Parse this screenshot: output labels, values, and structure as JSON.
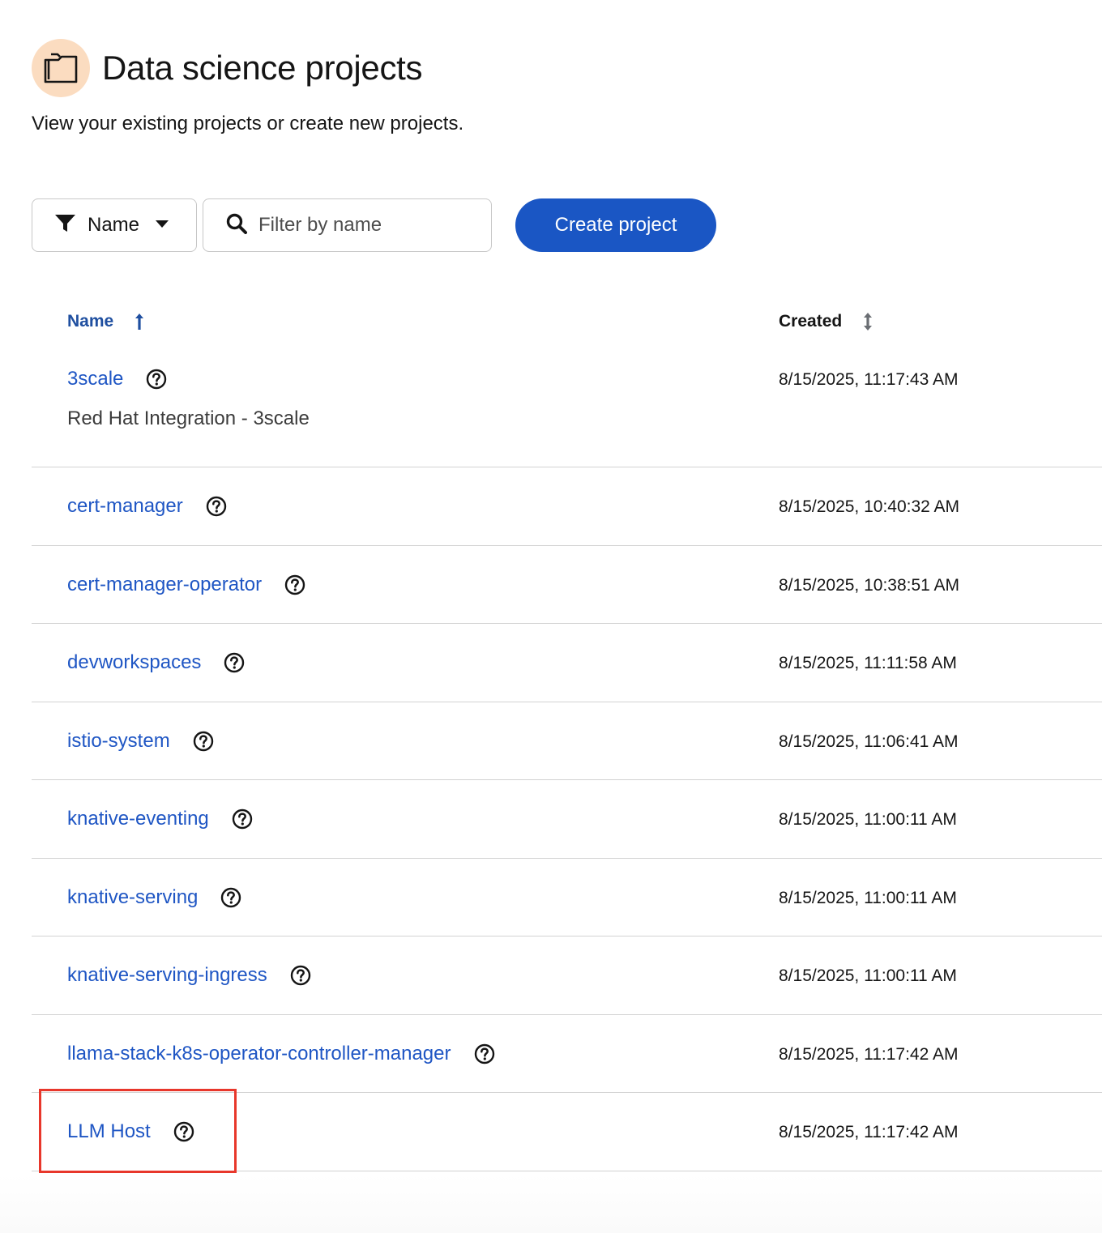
{
  "header": {
    "icon": "folder-icon",
    "title": "Data science projects",
    "description": "View your existing projects or create new projects."
  },
  "toolbar": {
    "filter_icon": "filter-icon",
    "filter_attribute": "Name",
    "search_placeholder": "Filter by name",
    "create_label": "Create project"
  },
  "table": {
    "columns": [
      {
        "label": "Name",
        "sort": "ascending"
      },
      {
        "label": "Created",
        "sort": "none"
      }
    ],
    "rows": [
      {
        "name": "3scale",
        "subtitle": "Red Hat Integration - 3scale",
        "created": "8/15/2025, 11:17:43 AM"
      },
      {
        "name": "cert-manager",
        "subtitle": "",
        "created": "8/15/2025, 10:40:32 AM"
      },
      {
        "name": "cert-manager-operator",
        "subtitle": "",
        "created": "8/15/2025, 10:38:51 AM"
      },
      {
        "name": "devworkspaces",
        "subtitle": "",
        "created": "8/15/2025, 11:11:58 AM"
      },
      {
        "name": "istio-system",
        "subtitle": "",
        "created": "8/15/2025, 11:06:41 AM"
      },
      {
        "name": "knative-eventing",
        "subtitle": "",
        "created": "8/15/2025, 11:00:11 AM"
      },
      {
        "name": "knative-serving",
        "subtitle": "",
        "created": "8/15/2025, 11:00:11 AM"
      },
      {
        "name": "knative-serving-ingress",
        "subtitle": "",
        "created": "8/15/2025, 11:00:11 AM"
      },
      {
        "name": "llama-stack-k8s-operator-controller-manager",
        "subtitle": "",
        "created": "8/15/2025, 11:17:42 AM"
      },
      {
        "name": "LLM Host",
        "subtitle": "",
        "created": "8/15/2025, 11:17:42 AM"
      }
    ]
  },
  "colors": {
    "primary": "#1a56c4",
    "link": "#1f56c4",
    "header_icon_bg": "#fbdcc0",
    "highlight": "#e8372b"
  }
}
